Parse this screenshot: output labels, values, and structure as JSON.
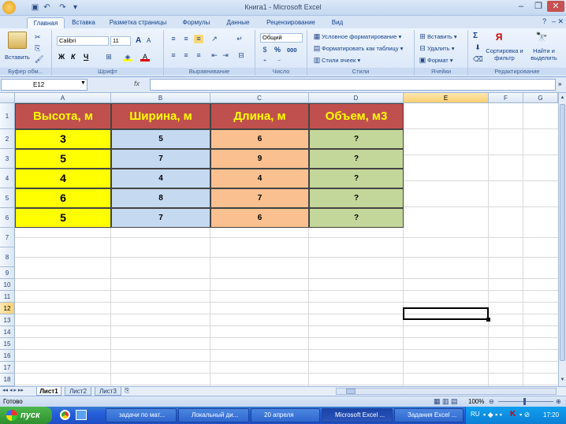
{
  "window": {
    "title": "Книга1 - Microsoft Excel"
  },
  "ribbon_tabs": [
    "Главная",
    "Вставка",
    "Разметка страницы",
    "Формулы",
    "Данные",
    "Рецензирование",
    "Вид"
  ],
  "clipboard": {
    "paste_label": "Вставить",
    "group_label": "Буфер обм..."
  },
  "font": {
    "name": "Calibri",
    "size": "11",
    "group_label": "Шрифт",
    "bold": "Ж",
    "italic": "К",
    "underline": "Ч",
    "grow": "A",
    "shrink": "A"
  },
  "alignment": {
    "group_label": "Выравнивание"
  },
  "number": {
    "format": "Общий",
    "percent": "%",
    "thousands": "000",
    "group_label": "Число"
  },
  "styles": {
    "conditional": "Условное форматирование",
    "as_table": "Форматировать как таблицу",
    "cell_styles": "Стили ячеек",
    "group_label": "Стили"
  },
  "cells": {
    "insert": "Вставить",
    "delete": "Удалить",
    "format": "Формат",
    "group_label": "Ячейки"
  },
  "editing": {
    "sigma": "Σ",
    "sort": "Сортировка и фильтр",
    "find": "Найти и выделить",
    "group_label": "Редактирование"
  },
  "formula_bar": {
    "name_box": "E12",
    "fx": "fx",
    "value": ""
  },
  "columns": [
    "A",
    "B",
    "C",
    "D",
    "E",
    "F",
    "G"
  ],
  "rows": [
    "1",
    "2",
    "3",
    "4",
    "5",
    "6",
    "7",
    "8",
    "9",
    "10",
    "11",
    "12",
    "13",
    "14",
    "15",
    "16",
    "17",
    "18"
  ],
  "selected": {
    "column": "E",
    "row": "12"
  },
  "table": {
    "headers": [
      "Высота, м",
      "Ширина, м",
      "Длина, м",
      "Объем, м3"
    ],
    "data": [
      [
        "3",
        "5",
        "6",
        "?"
      ],
      [
        "5",
        "7",
        "9",
        "?"
      ],
      [
        "4",
        "4",
        "4",
        "?"
      ],
      [
        "6",
        "8",
        "7",
        "?"
      ],
      [
        "5",
        "7",
        "6",
        "?"
      ]
    ]
  },
  "colors": {
    "header_bg": "#c0504d",
    "header_text": "#ffff00",
    "col_a": "#ffff00",
    "col_b": "#c5d9f1",
    "col_c": "#fac090",
    "col_d": "#c4d79b"
  },
  "sheets": [
    "Лист1",
    "Лист2",
    "Лист3"
  ],
  "status": {
    "ready": "Готово",
    "zoom": "100%"
  },
  "taskbar": {
    "start": "пуск",
    "buttons": [
      "задачи по мат...",
      "Локальный ди...",
      "20 апреля",
      "Microsoft Excel ...",
      "Задания Excel ..."
    ],
    "lang": "RU",
    "clock": "17:20"
  }
}
